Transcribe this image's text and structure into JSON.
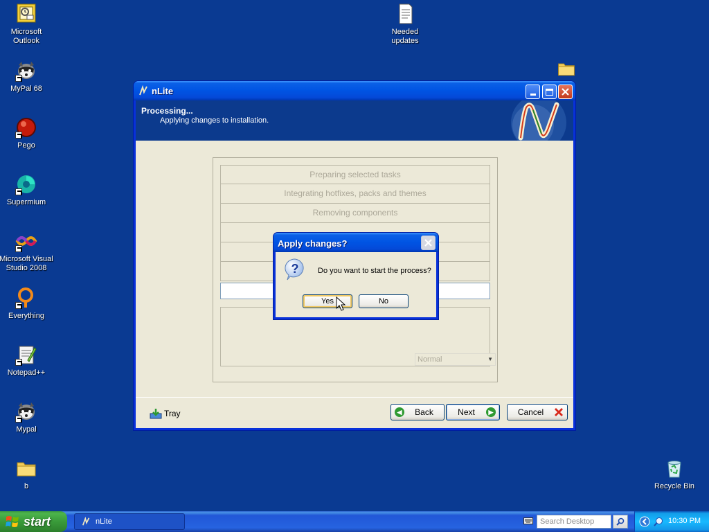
{
  "desktop": {
    "icons": [
      {
        "label": "Microsoft Outlook"
      },
      {
        "label": "MyPal 68"
      },
      {
        "label": "Pego"
      },
      {
        "label": "Supermium"
      },
      {
        "label": "Microsoft Visual Studio 2008"
      },
      {
        "label": "Everything"
      },
      {
        "label": "Notepad++"
      },
      {
        "label": "Mypal"
      },
      {
        "label": "b"
      },
      {
        "label": "Needed updates"
      },
      {
        "label": "Recycle Bin"
      }
    ]
  },
  "window": {
    "title": "nLite",
    "header_title": "Processing...",
    "header_subtitle": "Applying changes to installation.",
    "tasks": [
      "Preparing selected tasks",
      "Integrating hotfixes, packs and themes",
      "Removing components",
      "",
      "",
      ""
    ],
    "priority": "Normal",
    "tray_label": "Tray",
    "back_label": "Back",
    "next_label": "Next",
    "cancel_label": "Cancel"
  },
  "dialog": {
    "title": "Apply changes?",
    "message": "Do you want to start the process?",
    "yes_label": "Yes",
    "no_label": "No"
  },
  "taskbar": {
    "start_label": "start",
    "task_item_label": "nLite",
    "search_placeholder": "Search Desktop",
    "clock": "10:30 PM"
  }
}
